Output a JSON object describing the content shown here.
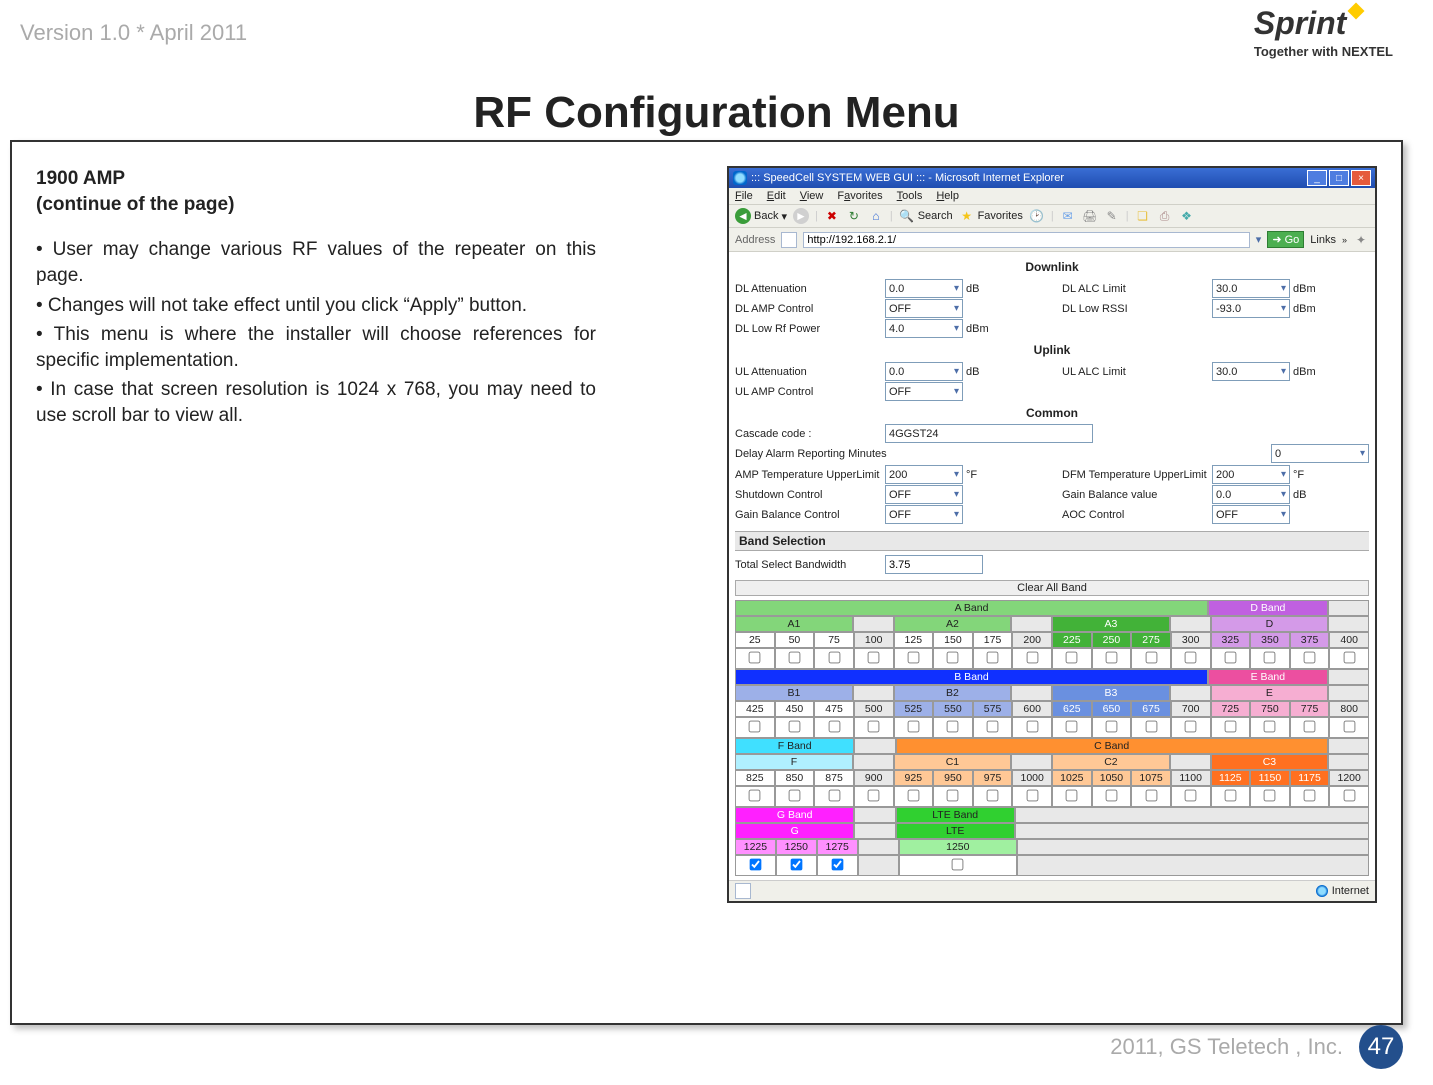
{
  "meta": {
    "version": "Version 1.0 * April 2011",
    "brand": "Sprint",
    "tagline": "Together with NEXTEL",
    "title": "RF Configuration Menu",
    "copyright": "2011, GS Teletech , Inc.",
    "pagenum": "47"
  },
  "left": {
    "hdr1": "1900 AMP",
    "hdr2": "(continue of the page)",
    "b1": "• User may change various RF values of the repeater on this page.",
    "b2": "• Changes will not take effect until you click  “Apply” button.",
    "b3": "• This menu is where the installer will choose references for specific implementation.",
    "b4": "• In case that screen resolution is 1024 x 768, you may need to use scroll bar to view all."
  },
  "win": {
    "title": "::: SpeedCell SYSTEM WEB GUI ::: - Microsoft Internet Explorer",
    "menu": [
      "File",
      "Edit",
      "View",
      "Favorites",
      "Tools",
      "Help"
    ],
    "back": "Back",
    "search": "Search",
    "favorites": "Favorites",
    "addrlbl": "Address",
    "url": "http://192.168.2.1/",
    "go": "Go",
    "links": "Links"
  },
  "dl": {
    "hdr": "Downlink",
    "att_l": "DL Attenuation",
    "att_v": "0.0",
    "att_u": "dB",
    "amp_l": "DL AMP Control",
    "amp_v": "OFF",
    "low_l": "DL Low Rf Power",
    "low_v": "4.0",
    "low_u": "dBm",
    "alc_l": "DL ALC Limit",
    "alc_v": "30.0",
    "alc_u": "dBm",
    "rssi_l": "DL Low RSSI",
    "rssi_v": "-93.0",
    "rssi_u": "dBm"
  },
  "ul": {
    "hdr": "Uplink",
    "att_l": "UL Attenuation",
    "att_v": "0.0",
    "att_u": "dB",
    "amp_l": "UL AMP Control",
    "amp_v": "OFF",
    "alc_l": "UL ALC Limit",
    "alc_v": "30.0",
    "alc_u": "dBm"
  },
  "cm": {
    "hdr": "Common",
    "casc_l": "Cascade code :",
    "casc_v": "4GGST24",
    "delay_l": "Delay Alarm Reporting Minutes",
    "delay_v": "0",
    "ampT_l": "AMP Temperature UpperLimit",
    "ampT_v": "200",
    "ampT_u": "°F",
    "shut_l": "Shutdown Control",
    "shut_v": "OFF",
    "gbc_l": "Gain Balance Control",
    "gbc_v": "OFF",
    "dfmT_l": "DFM Temperature UpperLimit",
    "dfmT_v": "200",
    "dfmT_u": "°F",
    "gbv_l": "Gain Balance value",
    "gbv_v": "0.0",
    "gbv_u": "dB",
    "aoc_l": "AOC Control",
    "aoc_v": "OFF"
  },
  "bs": {
    "hdr": "Band Selection",
    "bw_l": "Total Select Bandwidth",
    "bw_v": "3.75",
    "clear": "Clear All Band"
  },
  "bands": {
    "f1": [
      "25",
      "50",
      "75",
      "100",
      "125",
      "150",
      "175",
      "200",
      "225",
      "250",
      "275",
      "300",
      "325",
      "350",
      "375",
      "400"
    ],
    "f2": [
      "425",
      "450",
      "475",
      "500",
      "525",
      "550",
      "575",
      "600",
      "625",
      "650",
      "675",
      "700",
      "725",
      "750",
      "775",
      "800"
    ],
    "f3": [
      "825",
      "850",
      "875",
      "900",
      "925",
      "950",
      "975",
      "1000",
      "1025",
      "1050",
      "1075",
      "1100",
      "1125",
      "1150",
      "1175",
      "1200"
    ],
    "f4": [
      "1225",
      "1250",
      "1275",
      "",
      "1250"
    ],
    "a": "A Band",
    "a1": "A1",
    "a2": "A2",
    "a3": "A3",
    "d": "D Band",
    "dL": "D",
    "b": "B Band",
    "b1": "B1",
    "b2": "B2",
    "b3": "B3",
    "e": "E Band",
    "eL": "E",
    "f": "F Band",
    "fL": "F",
    "c": "C Band",
    "c1": "C1",
    "c2": "C2",
    "c3": "C3",
    "g": "G Band",
    "gL": "G",
    "lte": "LTE Band",
    "lteL": "LTE"
  },
  "status": {
    "zone": "Internet"
  }
}
